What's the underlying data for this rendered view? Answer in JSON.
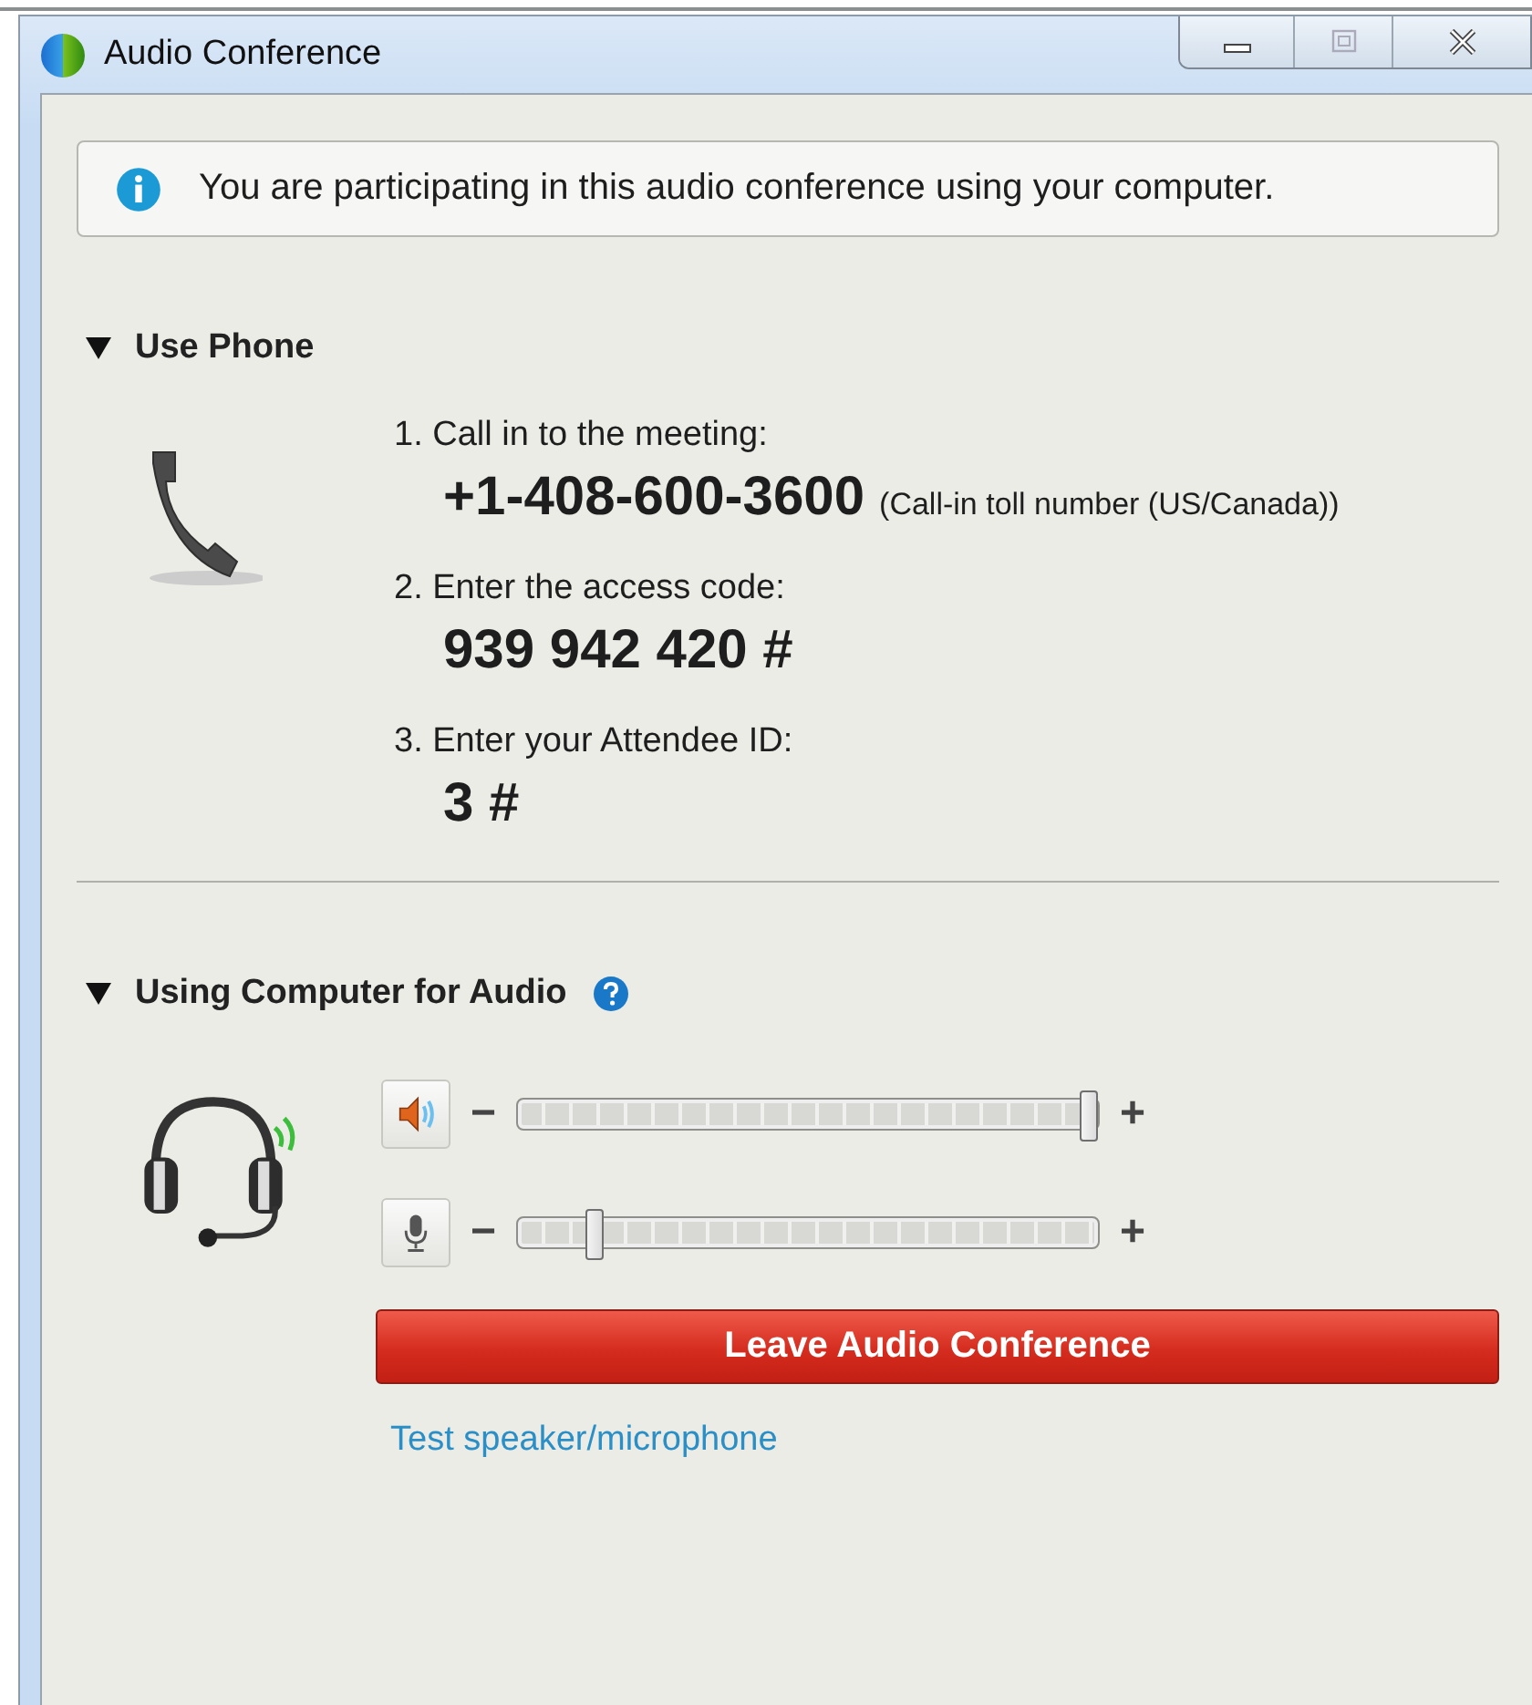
{
  "window": {
    "title": "Audio Conference"
  },
  "info": {
    "text": "You are participating in this audio conference using your computer."
  },
  "phone_section": {
    "title": "Use Phone",
    "expanded": true,
    "steps": [
      {
        "label": "1. Call in to the meeting:",
        "value": "+1-408-600-3600",
        "note": "(Call-in toll number (US/Canada))"
      },
      {
        "label": "2. Enter the access code:",
        "value": "939 942 420 #"
      },
      {
        "label": "3. Enter your Attendee ID:",
        "value": "3 #"
      }
    ]
  },
  "computer_section": {
    "title": "Using Computer for Audio",
    "expanded": true,
    "sliders": [
      {
        "kind": "speaker",
        "minus": "−",
        "plus": "+",
        "level": 1.0
      },
      {
        "kind": "microphone",
        "minus": "−",
        "plus": "+",
        "level": 0.12
      }
    ],
    "leave_button": "Leave Audio Conference",
    "test_link": "Test speaker/microphone"
  }
}
